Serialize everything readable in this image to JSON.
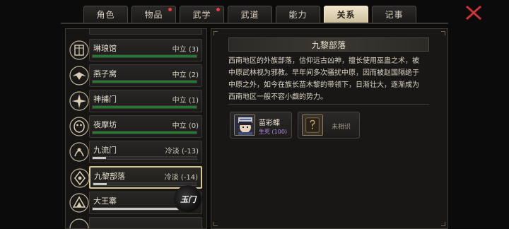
{
  "tabs": [
    {
      "label": "角色",
      "active": false,
      "dot": false
    },
    {
      "label": "物品",
      "active": false,
      "dot": true
    },
    {
      "label": "武学",
      "active": false,
      "dot": true
    },
    {
      "label": "武道",
      "active": false,
      "dot": false
    },
    {
      "label": "能力",
      "active": false,
      "dot": false
    },
    {
      "label": "关系",
      "active": true,
      "dot": false
    },
    {
      "label": "记事",
      "active": false,
      "dot": false
    }
  ],
  "factions": [
    {
      "name": "琳琅馆",
      "status": "中立 (3)",
      "progress": 1.0,
      "bar_color": "#1f7a32",
      "selected": false
    },
    {
      "name": "燕子窝",
      "status": "中立 (2)",
      "progress": 1.0,
      "bar_color": "#1f7a32",
      "selected": false
    },
    {
      "name": "神捕门",
      "status": "中立 (1)",
      "progress": 1.0,
      "bar_color": "#1f7a32",
      "selected": false
    },
    {
      "name": "夜摩坊",
      "status": "中立 (0)",
      "progress": 1.0,
      "bar_color": "#1f7a32",
      "selected": false
    },
    {
      "name": "九流门",
      "status": "冷淡 (-13)",
      "progress": 0.13,
      "bar_color": "#c8c8c8",
      "selected": false
    },
    {
      "name": "九黎部落",
      "status": "冷淡 (-14)",
      "progress": 0.13,
      "bar_color": "#c8c8c8",
      "selected": true
    },
    {
      "name": "大王寨",
      "status": "",
      "progress": 0.9,
      "bar_color": "#c8c8c8",
      "selected": false
    }
  ],
  "watermark_badge": "玉门",
  "detail": {
    "title": "九黎部落",
    "description": "西南地区的外族部落，信仰远古凶神，擅长使用巫蛊之术，被\n中原武林视为邪教。早年间多次骚扰中原，因而被赵国隔绝于\n中原之外，如今在族长苗木黎的带领下，日渐壮大，逐渐成为\n西南地区一般不容小觑的势力。",
    "members": [
      {
        "name": "苗彩蝶",
        "relation": "生死 (100)",
        "known": true
      },
      {
        "label": "未相识",
        "known": false
      }
    ]
  },
  "colors": {
    "tab_active_bg": "#e8dcc0",
    "selected_border": "#d9c793",
    "relation_purple": "#b48ce0",
    "close_red": "#d23a3f"
  }
}
